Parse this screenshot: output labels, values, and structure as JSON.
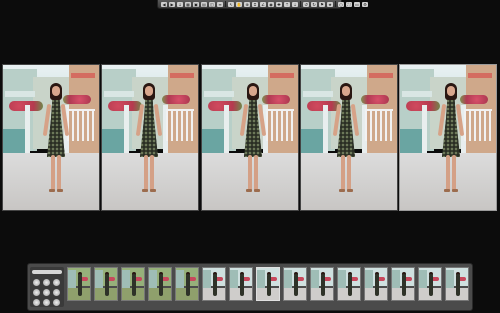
{
  "toolbar": {
    "buttons": [
      {
        "name": "nav-back-icon",
        "glyph": "◀"
      },
      {
        "name": "nav-forward-icon",
        "glyph": "▶"
      },
      {
        "name": "import-icon",
        "glyph": "↓"
      },
      {
        "name": "browser-icon",
        "glyph": "▦"
      },
      {
        "name": "viewer-icon",
        "glyph": "▣"
      },
      {
        "name": "light-table-icon",
        "glyph": "▤"
      },
      {
        "name": "compare-icon",
        "glyph": "◫"
      },
      {
        "name": "stack-icon",
        "glyph": "≡"
      },
      {
        "name": "separator"
      },
      {
        "name": "select-tool-icon",
        "glyph": "↖"
      },
      {
        "name": "hand-tool-icon",
        "glyph": "✋"
      },
      {
        "name": "zoom-tool-icon",
        "glyph": "⊕"
      },
      {
        "name": "crop-tool-icon",
        "glyph": "⌗"
      },
      {
        "name": "straighten-tool-icon",
        "glyph": "∠"
      },
      {
        "name": "redeye-tool-icon",
        "glyph": "◉"
      },
      {
        "name": "spot-tool-icon",
        "glyph": "✚"
      },
      {
        "name": "lift-tool-icon",
        "glyph": "⇡"
      },
      {
        "name": "stamp-tool-icon",
        "glyph": "⇣"
      },
      {
        "name": "separator"
      },
      {
        "name": "rotate-left-icon",
        "glyph": "↺"
      },
      {
        "name": "rotate-right-icon",
        "glyph": "↻"
      },
      {
        "name": "flag-icon",
        "glyph": "⚑"
      },
      {
        "name": "rating-icon",
        "glyph": "★"
      },
      {
        "name": "separator"
      },
      {
        "name": "loupe-icon",
        "glyph": "○"
      },
      {
        "name": "fullscreen-icon",
        "glyph": "⛶"
      },
      {
        "name": "hud-icon",
        "glyph": "▭"
      },
      {
        "name": "settings-icon",
        "glyph": "⚙"
      }
    ]
  },
  "viewer": {
    "frames": [
      {
        "name": "viewer-photo-1"
      },
      {
        "name": "viewer-photo-2"
      },
      {
        "name": "viewer-photo-3"
      },
      {
        "name": "viewer-photo-4"
      },
      {
        "name": "viewer-photo-5"
      }
    ]
  },
  "filmstrip": {
    "thumbs": [
      {
        "label": "",
        "tone": "green"
      },
      {
        "label": "",
        "tone": "green"
      },
      {
        "label": "",
        "tone": "green"
      },
      {
        "label": "",
        "tone": "green"
      },
      {
        "label": "",
        "tone": "green"
      },
      {
        "label": "",
        "tone": "street"
      },
      {
        "label": "",
        "tone": "street"
      },
      {
        "label": "",
        "tone": "street",
        "active": true
      },
      {
        "label": "",
        "tone": "street"
      },
      {
        "label": "",
        "tone": "street"
      },
      {
        "label": "",
        "tone": "street"
      },
      {
        "label": "",
        "tone": "street"
      },
      {
        "label": "",
        "tone": "street"
      },
      {
        "label": "",
        "tone": "street"
      },
      {
        "label": "",
        "tone": "street"
      }
    ]
  }
}
